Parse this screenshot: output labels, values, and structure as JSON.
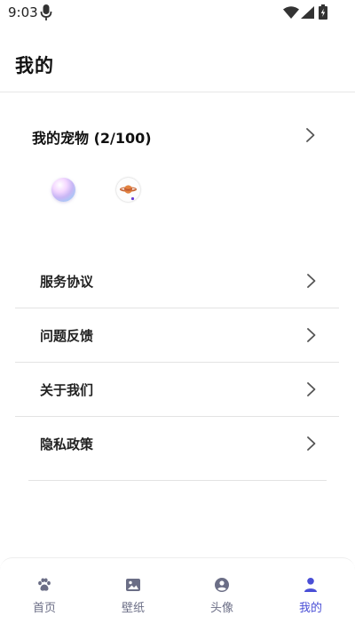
{
  "status_bar": {
    "time": "9:03",
    "icons": [
      "mic-icon",
      "wifi-icon",
      "signal-icon",
      "battery-icon"
    ]
  },
  "header": {
    "title": "我的"
  },
  "pets": {
    "title": "我的宠物 (2/100)",
    "items": [
      "pet-bubble-icon",
      "pet-planet-icon"
    ]
  },
  "menu": {
    "items": [
      {
        "label": "服务协议"
      },
      {
        "label": "问题反馈"
      },
      {
        "label": "关于我们"
      },
      {
        "label": "隐私政策"
      }
    ]
  },
  "bottom_nav": {
    "items": [
      {
        "label": "首页",
        "icon": "paw-icon",
        "active": false
      },
      {
        "label": "壁纸",
        "icon": "image-icon",
        "active": false
      },
      {
        "label": "头像",
        "icon": "user-circle-icon",
        "active": false
      },
      {
        "label": "我的",
        "icon": "person-icon",
        "active": true
      }
    ]
  },
  "colors": {
    "accent": "#4a4fd6",
    "inactive_nav": "#6b6e86",
    "divider": "#e3e3e3",
    "text": "#222222"
  }
}
